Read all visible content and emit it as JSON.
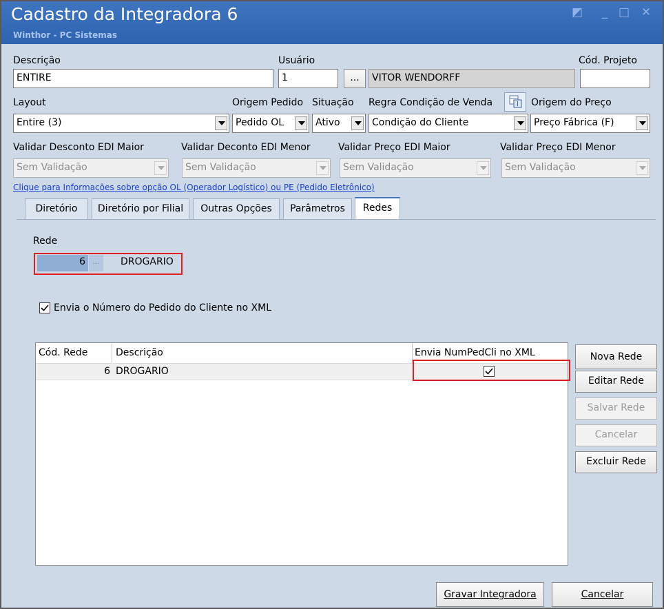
{
  "window": {
    "title": "Cadastro da Integradora 6",
    "subtitle": "Winthor - PC Sistemas",
    "controls": {
      "restore": "◩",
      "minimize": "_",
      "maximize": "□",
      "close": "✕"
    }
  },
  "form": {
    "descricao": {
      "label": "Descrição",
      "value": "ENTIRE"
    },
    "usuario": {
      "label": "Usuário",
      "code": "1",
      "lookup_button": "...",
      "name": "VITOR WENDORFF"
    },
    "cod_projeto": {
      "label": "Cód. Projeto",
      "value": ""
    },
    "layout": {
      "label": "Layout",
      "value": "Entire (3)"
    },
    "origem_pedido": {
      "label": "Origem Pedido",
      "value": "Pedido OL"
    },
    "situacao": {
      "label": "Situação",
      "value": "Ativo"
    },
    "regra_condicao": {
      "label": "Regra Condição de Venda",
      "value": "Condição do Cliente"
    },
    "origem_preco": {
      "label": "Origem do Preço",
      "value": "Preço Fábrica (F)"
    },
    "validar_desconto_maior": {
      "label": "Validar Desconto EDI Maior",
      "value": "Sem Validação"
    },
    "validar_deconto_menor": {
      "label": "Validar Deconto EDI Menor",
      "value": "Sem Validação"
    },
    "validar_preco_maior": {
      "label": "Validar Preço EDI Maior",
      "value": "Sem Validação"
    },
    "validar_preco_menor": {
      "label": "Validar Preço EDI Menor",
      "value": "Sem Validação"
    },
    "info_link": "Clique para Informações sobre opção OL (Operador Logístico) ou PE (Pedido Eletrônico)"
  },
  "tabs": [
    {
      "label": "Diretório"
    },
    {
      "label": "Diretório por Filial"
    },
    {
      "label": "Outras Opções"
    },
    {
      "label": "Parâmetros"
    },
    {
      "label": "Redes",
      "active": true
    }
  ],
  "redes": {
    "rede_label": "Rede",
    "rede_code": "6",
    "rede_lookup": "...",
    "rede_name": "DROGARIO",
    "checkbox_label": "Envia o Número do Pedido do Cliente no XML",
    "checkbox_checked": true,
    "grid": {
      "columns": [
        "Cód. Rede",
        "Descrição",
        "Envia NumPedCli no XML"
      ],
      "rows": [
        {
          "cod": "6",
          "descricao": "DROGARIO",
          "envia": true
        }
      ]
    },
    "buttons": {
      "nova": "Nova Rede",
      "editar": "Editar Rede",
      "salvar": "Salvar Rede",
      "cancelar": "Cancelar",
      "excluir": "Excluir Rede"
    }
  },
  "footer": {
    "gravar": "Gravar Integradora",
    "cancelar": "Cancelar"
  },
  "colors": {
    "titlebar": "#3e74c0",
    "body_bg": "#cdd9e6",
    "highlight_red": "#e02020",
    "link": "#1a3fd6"
  }
}
